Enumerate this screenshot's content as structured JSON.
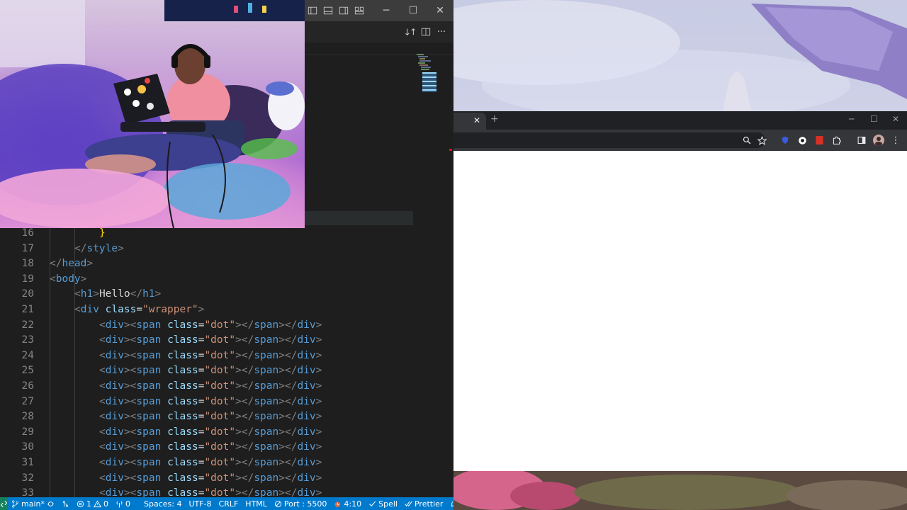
{
  "vscode": {
    "title_bar": {
      "icons": [
        "toggle-primary-sidebar-icon",
        "toggle-panel-icon",
        "toggle-secondary-sidebar-icon",
        "customize-layout-icon"
      ],
      "window_controls": {
        "minimize": "─",
        "maximize": "☐",
        "close": "✕"
      }
    },
    "editor_actions": {
      "icons": [
        "open-changes-icon",
        "split-editor-icon",
        "more-actions-icon"
      ],
      "more": "···"
    },
    "editor": {
      "lines": [
        {
          "num": "16",
          "indent": 2,
          "parts": [
            {
              "t": "br",
              "v": "}"
            }
          ]
        },
        {
          "num": "17",
          "indent": 1,
          "parts": [
            {
              "t": "tag",
              "v": "</"
            },
            {
              "t": "tn",
              "v": "style"
            },
            {
              "t": "tag",
              "v": ">"
            }
          ]
        },
        {
          "num": "18",
          "indent": 0,
          "parts": [
            {
              "t": "tag",
              "v": "</"
            },
            {
              "t": "tn",
              "v": "head"
            },
            {
              "t": "tag",
              "v": ">"
            }
          ]
        },
        {
          "num": "19",
          "indent": 0,
          "parts": [
            {
              "t": "tag",
              "v": "<"
            },
            {
              "t": "tn",
              "v": "body"
            },
            {
              "t": "tag",
              "v": ">"
            }
          ]
        },
        {
          "num": "20",
          "indent": 1,
          "parts": [
            {
              "t": "tag",
              "v": "<"
            },
            {
              "t": "tn",
              "v": "h1"
            },
            {
              "t": "tag",
              "v": ">"
            },
            {
              "t": "tx",
              "v": "Hello"
            },
            {
              "t": "tag",
              "v": "</"
            },
            {
              "t": "tn",
              "v": "h1"
            },
            {
              "t": "tag",
              "v": ">"
            }
          ]
        },
        {
          "num": "21",
          "indent": 1,
          "parts": [
            {
              "t": "tag",
              "v": "<"
            },
            {
              "t": "tn",
              "v": "div"
            },
            {
              "t": "tx",
              "v": " "
            },
            {
              "t": "at",
              "v": "class"
            },
            {
              "t": "tx",
              "v": "="
            },
            {
              "t": "av",
              "v": "\"wrapper\""
            },
            {
              "t": "tag",
              "v": ">"
            }
          ]
        },
        {
          "num": "22",
          "indent": 2,
          "dot": true
        },
        {
          "num": "23",
          "indent": 2,
          "dot": true
        },
        {
          "num": "24",
          "indent": 2,
          "dot": true
        },
        {
          "num": "25",
          "indent": 2,
          "dot": true
        },
        {
          "num": "26",
          "indent": 2,
          "dot": true
        },
        {
          "num": "27",
          "indent": 2,
          "dot": true
        },
        {
          "num": "28",
          "indent": 2,
          "dot": true
        },
        {
          "num": "29",
          "indent": 2,
          "dot": true
        },
        {
          "num": "30",
          "indent": 2,
          "dot": true
        },
        {
          "num": "31",
          "indent": 2,
          "dot": true
        },
        {
          "num": "32",
          "indent": 2,
          "dot": true
        },
        {
          "num": "33",
          "indent": 2,
          "dot": true
        }
      ],
      "dot_line_parts": [
        {
          "t": "tag",
          "v": "<"
        },
        {
          "t": "tn",
          "v": "div"
        },
        {
          "t": "tag",
          "v": "><"
        },
        {
          "t": "tn",
          "v": "span"
        },
        {
          "t": "tx",
          "v": " "
        },
        {
          "t": "at",
          "v": "class"
        },
        {
          "t": "tx",
          "v": "="
        },
        {
          "t": "av",
          "v": "\"dot\""
        },
        {
          "t": "tag",
          "v": "></"
        },
        {
          "t": "tn",
          "v": "span"
        },
        {
          "t": "tag",
          "v": "></"
        },
        {
          "t": "tn",
          "v": "div"
        },
        {
          "t": "tag",
          "v": ">"
        }
      ]
    },
    "status_bar": {
      "branch": "main*",
      "errors": "1",
      "warnings": "0",
      "ports": "0",
      "spaces": "Spaces: 4",
      "encoding": "UTF-8",
      "eol": "CRLF",
      "language": "HTML",
      "live_server": "Port : 5500",
      "time": "4:10",
      "spell": "Spell",
      "prettier": "Prettier"
    },
    "colors": {
      "status_bar": "#007acc",
      "remote": "#16825d",
      "editor_bg": "#1e1e1e"
    }
  },
  "browser": {
    "tab_close": "✕",
    "new_tab": "+",
    "window_controls": {
      "minimize": "─",
      "maximize": "☐",
      "close": "✕"
    },
    "toolbar_icons": [
      "zoom-icon",
      "bookmark-star-icon",
      "shield-extension-icon",
      "extension-icon",
      "red-extension-icon",
      "puzzle-extensions-icon",
      "side-panel-icon",
      "profile-avatar",
      "kebab-menu-icon"
    ],
    "more": "⋮"
  },
  "webcam": {
    "description_icon": "webcam-feed"
  }
}
